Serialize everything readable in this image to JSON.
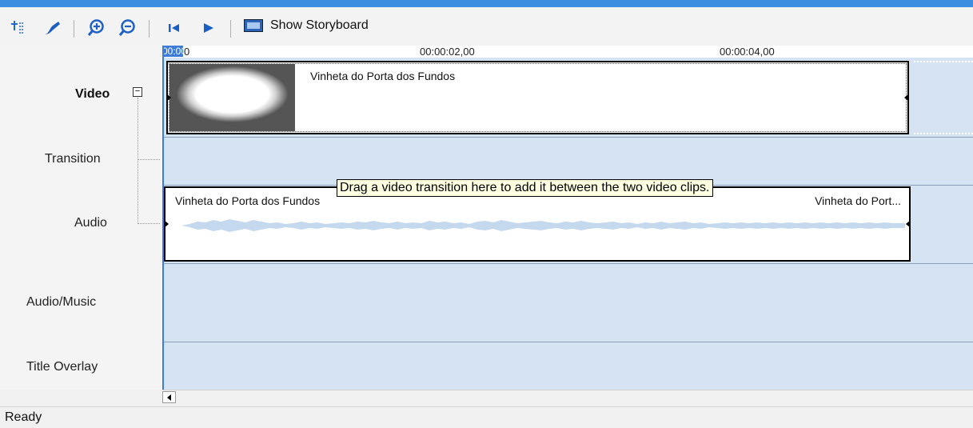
{
  "toolbar": {
    "show_storyboard_label": "Show Storyboard"
  },
  "ruler": {
    "playhead_time": "00:00",
    "tick_labels": [
      "0",
      "00:00:02,00",
      "00:00:04,00"
    ]
  },
  "tracks": {
    "video": "Video",
    "transition": "Transition",
    "audio": "Audio",
    "audio_music": "Audio/Music",
    "title_overlay": "Title Overlay"
  },
  "clips": {
    "video_clip_title": "Vinheta do Porta dos Fundos",
    "audio_clip_title_left": "Vinheta do Porta dos Fundos",
    "audio_clip_title_right": "Vinheta do Port..."
  },
  "tooltip": {
    "text": "Drag a video transition here to add it between the two video clips."
  },
  "status": {
    "text": "Ready"
  },
  "colors": {
    "accent": "#3c8fe0",
    "timeline_bg": "#d6e3f3",
    "waveform": "#c5d9ee",
    "tooltip_bg": "#ffffe1"
  },
  "icons": [
    "narrate-timeline-icon",
    "set-audio-levels-icon",
    "zoom-in-icon",
    "zoom-out-icon",
    "rewind-icon",
    "play-icon",
    "storyboard-icon",
    "collapse-icon",
    "scroll-left-icon"
  ]
}
